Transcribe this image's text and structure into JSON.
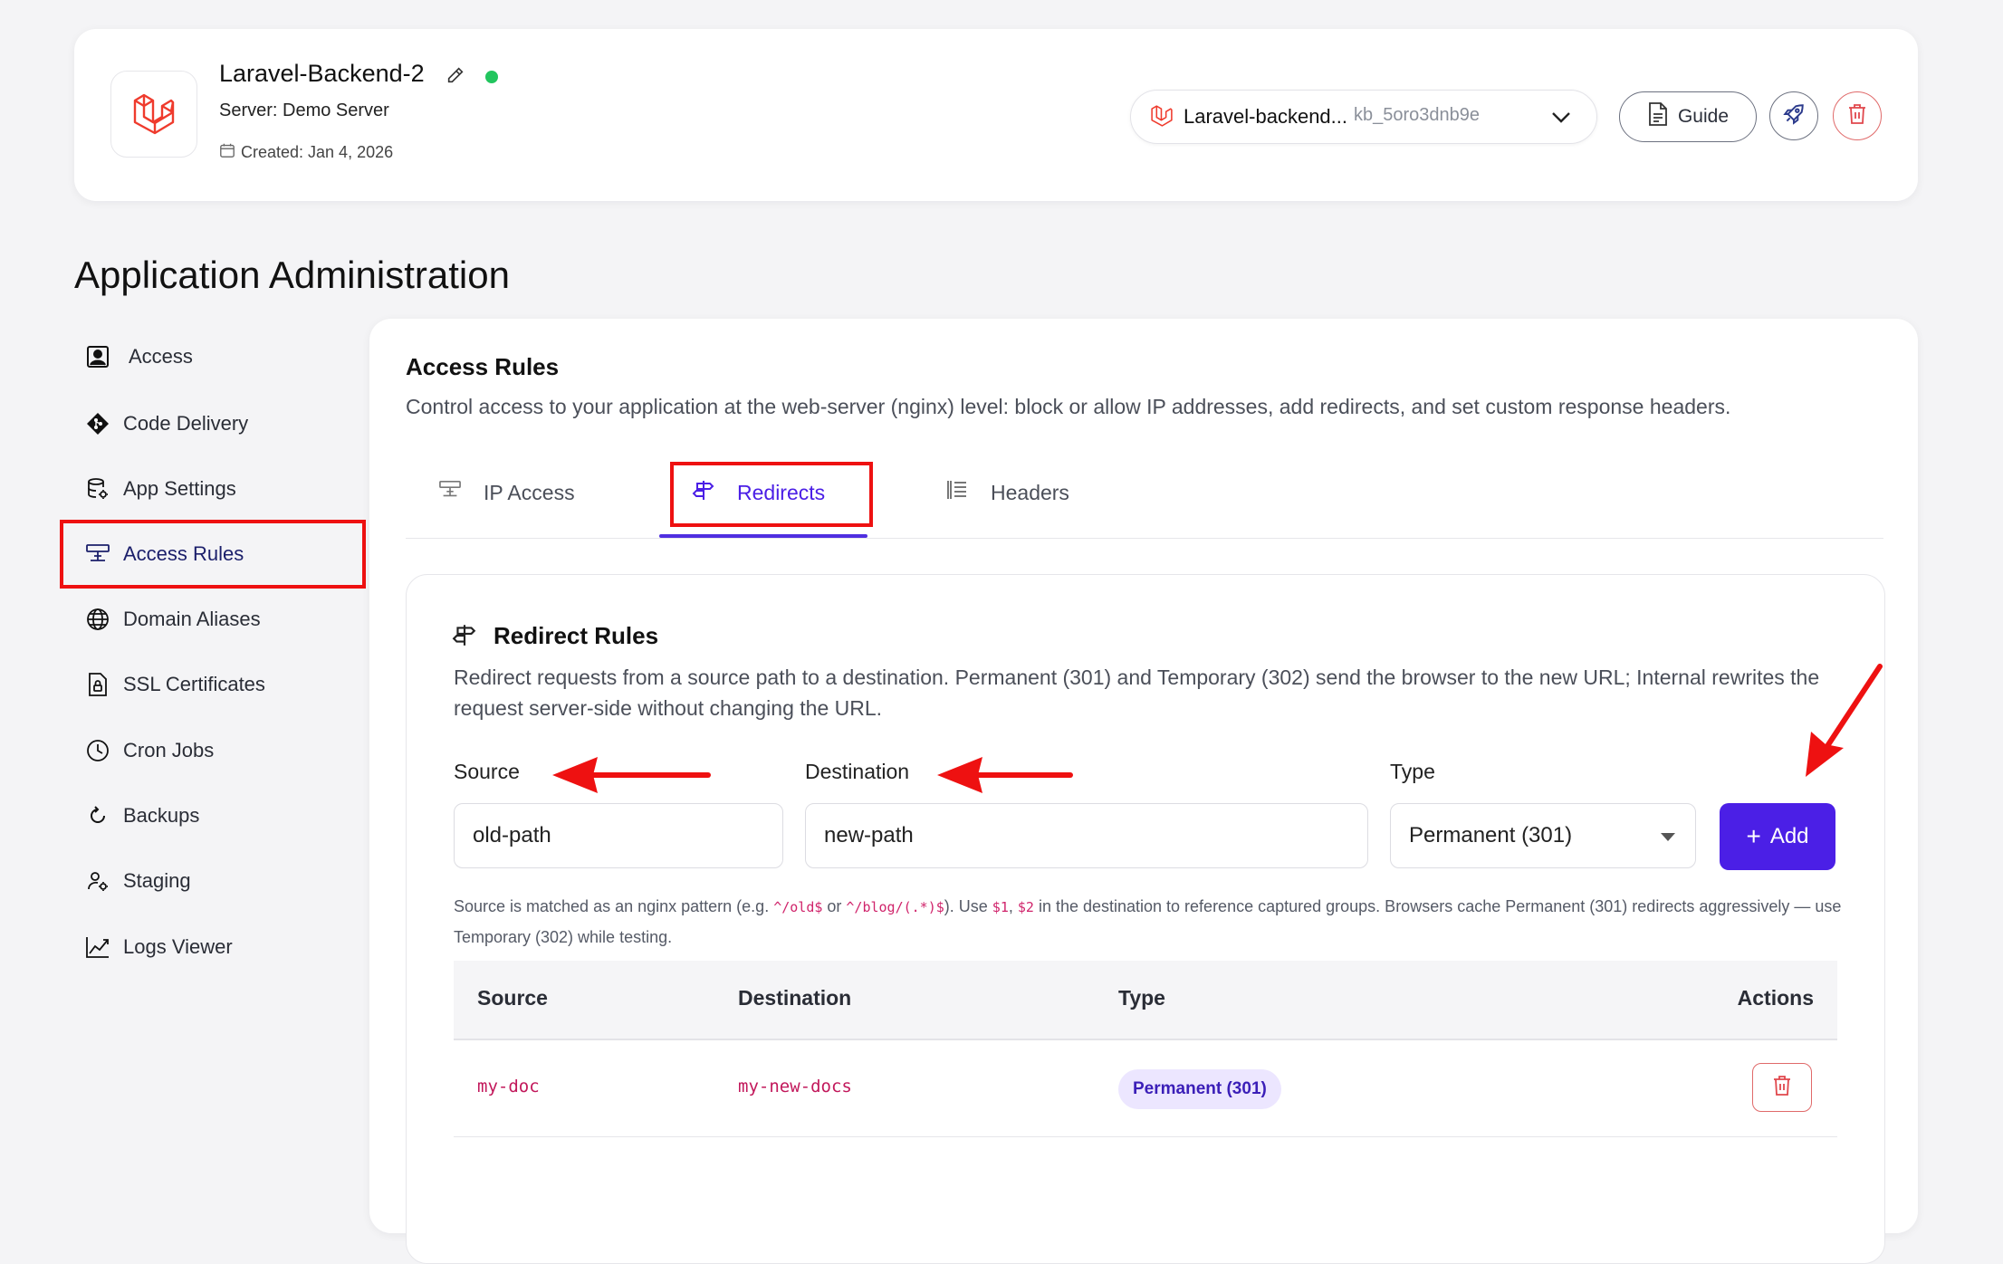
{
  "header": {
    "app_name": "Laravel-Backend-2",
    "server": "Server: Demo Server",
    "created": "Created: Jan 4, 2026",
    "selector_name": "Laravel-backend...",
    "selector_key": "kb_5oro3dnb9e",
    "guide_label": "Guide",
    "status_color": "#22c55e"
  },
  "page_title": "Application Administration",
  "sidebar": {
    "items": [
      {
        "label": "Access",
        "icon": "user-square-icon"
      },
      {
        "label": "Code Delivery",
        "icon": "git-diamond-icon"
      },
      {
        "label": "App Settings",
        "icon": "database-gear-icon"
      },
      {
        "label": "Access Rules",
        "icon": "access-rules-icon",
        "active": true
      },
      {
        "label": "Domain Aliases",
        "icon": "globe-icon"
      },
      {
        "label": "SSL Certificates",
        "icon": "ssl-certificate-icon"
      },
      {
        "label": "Cron Jobs",
        "icon": "clock-icon"
      },
      {
        "label": "Backups",
        "icon": "refresh-icon"
      },
      {
        "label": "Staging",
        "icon": "users-gear-icon"
      },
      {
        "label": "Logs Viewer",
        "icon": "chart-line-icon"
      }
    ]
  },
  "main": {
    "title": "Access Rules",
    "description": "Control access to your application at the web-server (nginx) level: block or allow IP addresses, add redirects, and set custom response headers.",
    "tabs": [
      {
        "label": "IP Access"
      },
      {
        "label": "Redirects",
        "active": true
      },
      {
        "label": "Headers"
      }
    ]
  },
  "redirects": {
    "title": "Redirect Rules",
    "description": "Redirect requests from a source path to a destination. Permanent (301) and Temporary (302) send the browser to the new URL; Internal rewrites the request server-side without changing the URL.",
    "source_label": "Source",
    "source_value": "old-path",
    "destination_label": "Destination",
    "destination_value": "new-path",
    "type_label": "Type",
    "type_value": "Permanent (301)",
    "add_label": "Add",
    "help_prefix": "Source is matched as an nginx pattern (e.g. ",
    "help_code1": "^/old$",
    "help_or": " or ",
    "help_code2": "^/blog/(.*)$",
    "help_mid": "). Use ",
    "help_code3": "$1",
    "help_comma": ", ",
    "help_code4": "$2",
    "help_suffix": " in the destination to reference captured groups. Browsers cache Permanent (301) redirects aggressively — use Temporary (302) while testing.",
    "table": {
      "headers": [
        "Source",
        "Destination",
        "Type",
        "Actions"
      ],
      "rows": [
        {
          "source": "my-doc",
          "destination": "my-new-docs",
          "type": "Permanent (301)"
        }
      ]
    }
  },
  "colors": {
    "accent": "#4b1fe6",
    "highlight_red": "#ee1111",
    "badge_bg": "#ece6ff"
  }
}
